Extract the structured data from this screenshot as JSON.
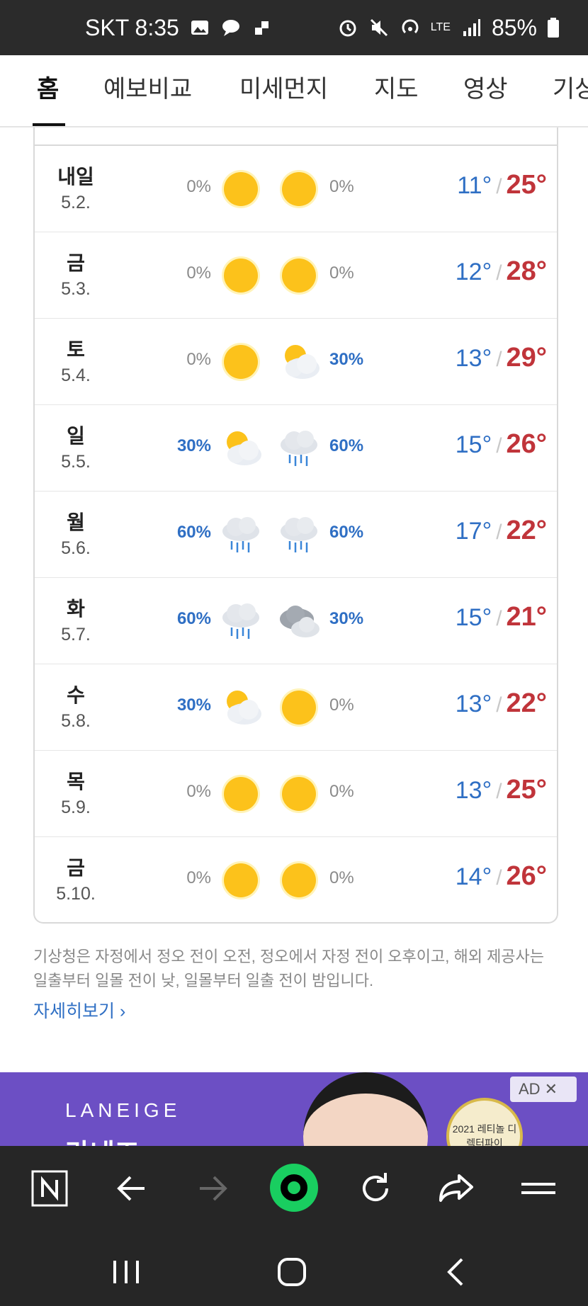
{
  "status_bar": {
    "carrier_time": "SKT 8:35",
    "battery": "85%",
    "network": "LTE"
  },
  "tabs": [
    {
      "label": "홈",
      "active": true
    },
    {
      "label": "예보비교",
      "active": false
    },
    {
      "label": "미세먼지",
      "active": false
    },
    {
      "label": "지도",
      "active": false
    },
    {
      "label": "영상",
      "active": false
    },
    {
      "label": "기상",
      "active": false
    }
  ],
  "forecast": [
    {
      "day": "내일",
      "date": "5.2.",
      "am_pct": "0%",
      "am_icon": "sun-icon",
      "pm_icon": "sun-icon",
      "pm_pct": "0%",
      "low": "11°",
      "high": "25°"
    },
    {
      "day": "금",
      "date": "5.3.",
      "am_pct": "0%",
      "am_icon": "sun-icon",
      "pm_icon": "sun-icon",
      "pm_pct": "0%",
      "low": "12°",
      "high": "28°"
    },
    {
      "day": "토",
      "date": "5.4.",
      "am_pct": "0%",
      "am_icon": "sun-icon",
      "pm_icon": "partly-cloudy-icon",
      "pm_pct": "30%",
      "low": "13°",
      "high": "29°"
    },
    {
      "day": "일",
      "date": "5.5.",
      "am_pct": "30%",
      "am_icon": "partly-cloudy-icon",
      "pm_icon": "rain-icon",
      "pm_pct": "60%",
      "low": "15°",
      "high": "26°"
    },
    {
      "day": "월",
      "date": "5.6.",
      "am_pct": "60%",
      "am_icon": "rain-icon",
      "pm_icon": "rain-icon",
      "pm_pct": "60%",
      "low": "17°",
      "high": "22°"
    },
    {
      "day": "화",
      "date": "5.7.",
      "am_pct": "60%",
      "am_icon": "rain-icon",
      "pm_icon": "cloudy-icon",
      "pm_pct": "30%",
      "low": "15°",
      "high": "21°"
    },
    {
      "day": "수",
      "date": "5.8.",
      "am_pct": "30%",
      "am_icon": "partly-cloudy-icon",
      "pm_icon": "sun-icon",
      "pm_pct": "0%",
      "low": "13°",
      "high": "22°"
    },
    {
      "day": "목",
      "date": "5.9.",
      "am_pct": "0%",
      "am_icon": "sun-icon",
      "pm_icon": "sun-icon",
      "pm_pct": "0%",
      "low": "13°",
      "high": "25°"
    },
    {
      "day": "금",
      "date": "5.10.",
      "am_pct": "0%",
      "am_icon": "sun-icon",
      "pm_icon": "sun-icon",
      "pm_pct": "0%",
      "low": "14°",
      "high": "26°"
    }
  ],
  "temp_separator": "/",
  "notice": "기상청은 자정에서 정오 전이 오전, 정오에서 자정 전이 오후이고, 해외 제공사는 일출부터 일몰 전이 낮, 일몰부터 일출 전이 밤입니다.",
  "more_link": "자세히보기",
  "ad": {
    "brand": "LANEIGE",
    "headline": "라네즈",
    "badge": "2021 레티놀 디렉터파이",
    "tag": "AD ✕"
  },
  "colors": {
    "low_temp": "#2f6fc4",
    "high_temp": "#c0343a",
    "rain_pct": "#2f6fc4",
    "ad_bg": "#6c4fc4",
    "toolbar_bg": "#262626",
    "home_button": "#19ce60"
  }
}
